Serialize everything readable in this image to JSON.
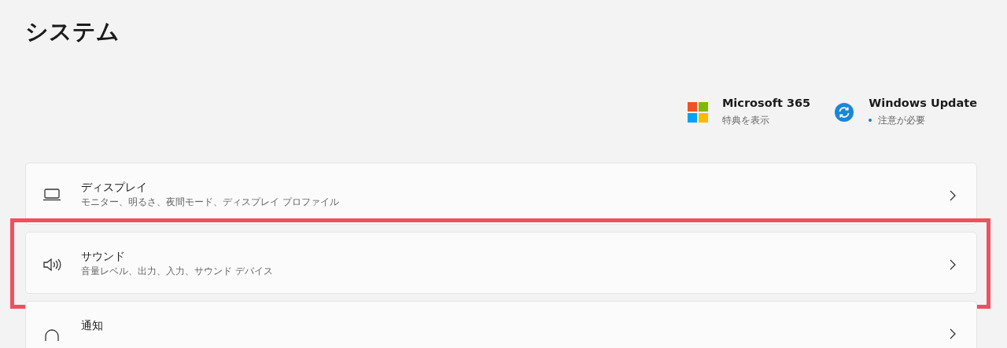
{
  "title": "システム",
  "tiles": [
    {
      "kind": "office",
      "title": "Microsoft 365",
      "subtitle": "特典を表示",
      "dot": false
    },
    {
      "kind": "update",
      "title": "Windows Update",
      "subtitle": "注意が必要",
      "dot": true
    }
  ],
  "items": [
    {
      "kind": "display",
      "label": "ディスプレイ",
      "description": "モニター、明るさ、夜間モード、ディスプレイ プロファイル",
      "highlighted": false
    },
    {
      "kind": "sound",
      "label": "サウンド",
      "description": "音量レベル、出力、入力、サウンド デバイス",
      "highlighted": true
    },
    {
      "kind": "notify",
      "label": "通知",
      "highlighted": false
    }
  ]
}
